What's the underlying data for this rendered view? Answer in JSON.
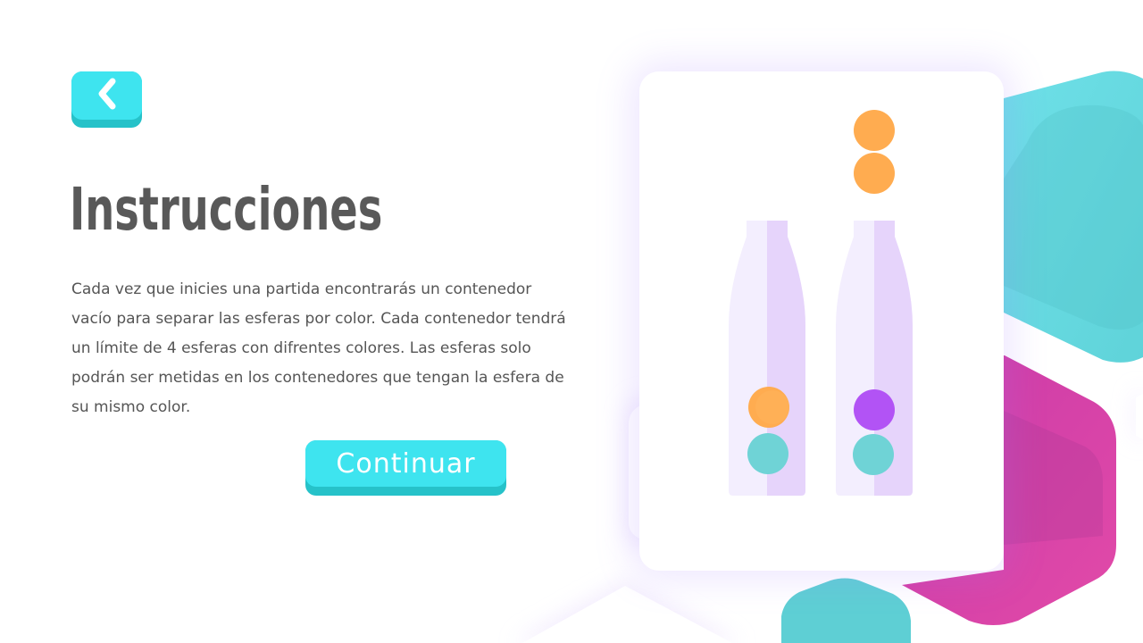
{
  "nav": {
    "back_icon": "chevron-left-icon"
  },
  "title": "Instrucciones",
  "instructions": "Cada vez que inicies una partida encontrarás un contenedor vacío para separar las esferas por color.  Cada contenedor tendrá un límite de 4 esferas con difrentes colores. Las esferas solo podrán ser metidas en los contenedores que tengan la esfera de su mismo color.",
  "continue_label": "Continuar",
  "colors": {
    "accent": "#3ee4ef",
    "accent_shadow": "#26c2c9",
    "title_text": "#595959",
    "body_text": "#555555",
    "orange_sphere": "#ffac50",
    "teal_sphere": "#6fd3d6",
    "purple_sphere": "#b253f5",
    "bottle_light": "#f3eefe",
    "bottle_dark": "#e6d4fb",
    "hex_cyan": "#5ddce4",
    "hex_magenta": "#e040a8"
  },
  "illustration": {
    "bottles": [
      {
        "name": "bottle-1",
        "spheres": [
          "orange",
          "teal"
        ]
      },
      {
        "name": "bottle-2",
        "spheres": [
          "purple",
          "teal"
        ]
      }
    ],
    "floating_spheres": [
      "orange",
      "orange"
    ]
  }
}
